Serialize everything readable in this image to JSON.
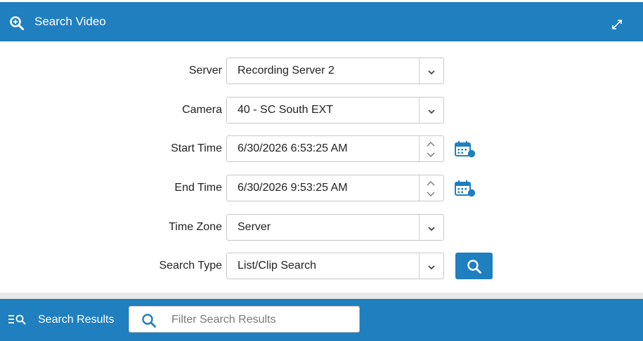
{
  "header": {
    "title": "Search Video",
    "icon": "zoom-search-icon",
    "expand_icon": "expand-icon"
  },
  "form": {
    "server": {
      "label": "Server",
      "value": "Recording Server 2"
    },
    "camera": {
      "label": "Camera",
      "value": "40 - SC South EXT"
    },
    "start_time": {
      "label": "Start Time",
      "value": "6/30/2026 6:53:25 AM"
    },
    "end_time": {
      "label": "End Time",
      "value": "6/30/2026 9:53:25 AM"
    },
    "time_zone": {
      "label": "Time Zone",
      "value": "Server"
    },
    "search_type": {
      "label": "Search Type",
      "value": "List/Clip Search"
    }
  },
  "results": {
    "title": "Search Results",
    "filter_placeholder": "Filter Search Results",
    "filter_value": ""
  },
  "colors": {
    "accent": "#1f7fbf",
    "white": "#ffffff",
    "divider": "#e9e9e9"
  }
}
